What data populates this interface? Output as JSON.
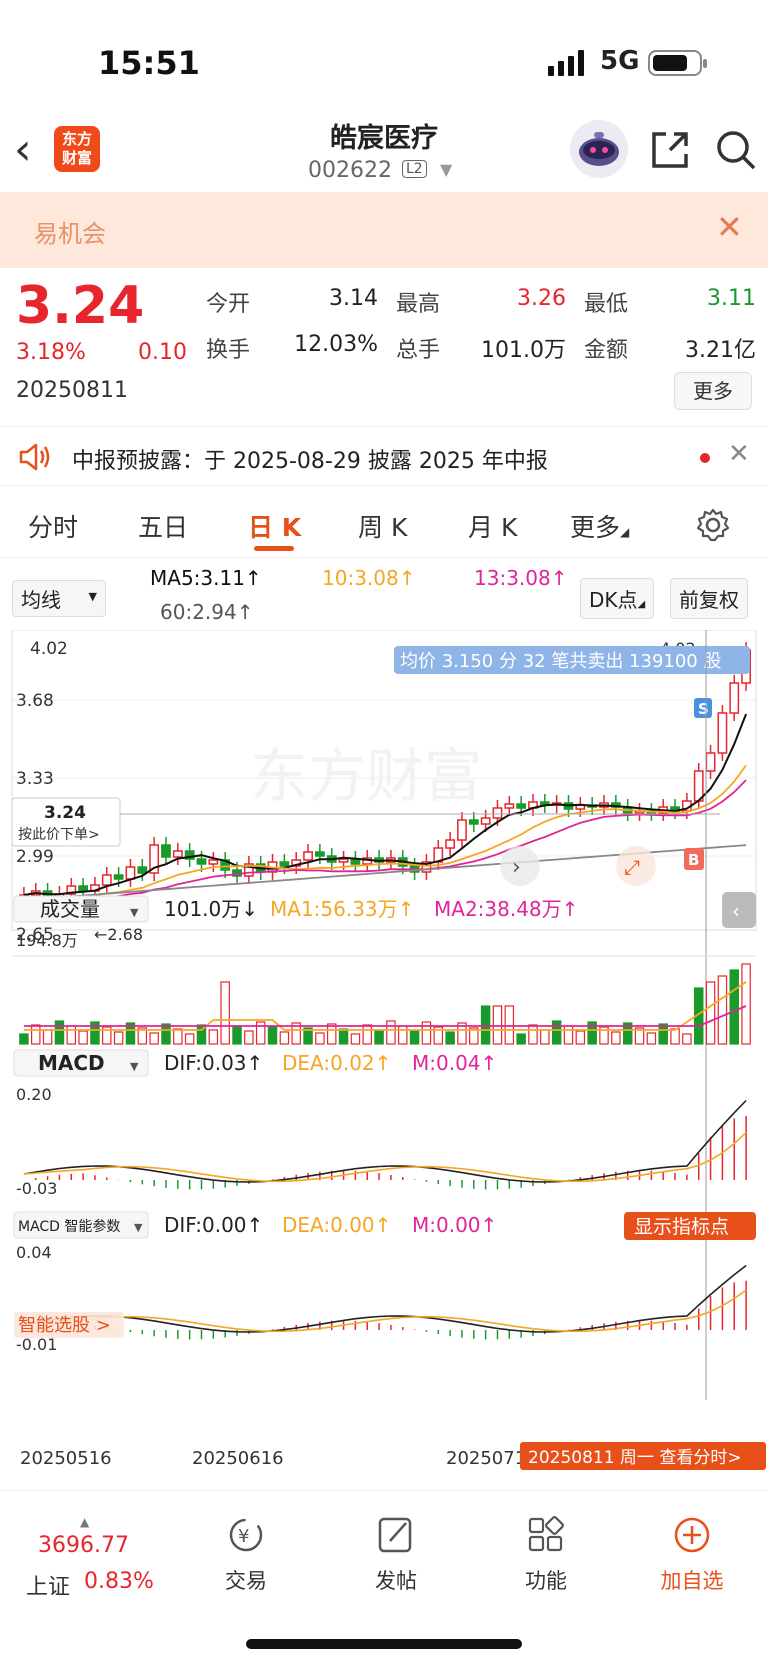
{
  "status": {
    "time": "15:51",
    "network": "5G"
  },
  "nav": {
    "logo_text_1": "东方",
    "logo_text_2": "财富",
    "stock_name": "皓宸医疗",
    "stock_code": "002622",
    "level": "L2"
  },
  "banner": {
    "text": "易机会"
  },
  "quote": {
    "price": "3.24",
    "change_pct": "3.18%",
    "change": "0.10",
    "date": "20250811",
    "open_label": "今开",
    "open": "3.14",
    "high_label": "最高",
    "high": "3.26",
    "low_label": "最低",
    "low": "3.11",
    "turnover_label": "换手",
    "turnover": "12.03%",
    "volume_label": "总手",
    "volume": "101.0万",
    "amount_label": "金额",
    "amount": "3.21亿",
    "more": "更多"
  },
  "notice": {
    "text": "中报预披露：于 2025-08-29 披露 2025 年中报"
  },
  "tabs": [
    "分时",
    "五日",
    "日 K",
    "周 K",
    "月 K",
    "更多"
  ],
  "active_tab": "日 K",
  "ma": {
    "selector": "均线",
    "ma5": "MA5:3.11↑",
    "ma10": "10:3.08↑",
    "ma13": "13:3.08↑",
    "ma60": "60:2.94↑",
    "dk_btn": "DK点",
    "adjust_btn": "前复权"
  },
  "kline": {
    "ymax": "4.02",
    "y1": "3.68",
    "y2": "3.33",
    "y3": "2.99",
    "ymin": "2.65",
    "price_tag": "3.24",
    "price_tag_sub": "按此价下单>",
    "low_mark": "←2.68",
    "high_mark": "4.02→",
    "tooltip": "均价 3.150 分 32 笔共卖出 139100 股",
    "watermark": "东方财富",
    "signal_s": "S",
    "signal_b": "B"
  },
  "volume": {
    "selector": "成交量",
    "value": "101.0万↓",
    "ma1": "MA1:56.33万↑",
    "ma2": "MA2:38.48万↑",
    "ymax": "194.8万"
  },
  "macd": {
    "selector": "MACD",
    "dif": "DIF:0.03↑",
    "dea": "DEA:0.02↑",
    "m": "M:0.04↑",
    "ymax": "0.20",
    "ymin": "-0.03"
  },
  "smart": {
    "selector": "MACD 智能参数",
    "dif": "DIF:0.00↑",
    "dea": "DEA:0.00↑",
    "m": "M:0.00↑",
    "show_btn": "显示指标点",
    "ymax": "0.04",
    "ymin": "-0.01",
    "pick_tag": "智能选股 >"
  },
  "xaxis": {
    "d1": "20250516",
    "d2": "20250616",
    "d3": "20250716",
    "d4": "20250811"
  },
  "cursor_tag": "20250811 周一 查看分时>",
  "footer": {
    "index_value": "3696.77",
    "index_name": "上证",
    "index_pct": "0.83%",
    "items": [
      "交易",
      "发帖",
      "功能",
      "加自选"
    ]
  },
  "colors": {
    "up": "#e6252c",
    "down": "#1a9a2a",
    "accent": "#e8501a",
    "ma5": "#111111",
    "ma10": "#f5a623",
    "ma13": "#e0249a",
    "ma60": "#888888"
  },
  "chart_data": {
    "type": "candlestick",
    "title": "",
    "series": [
      {
        "name": "MA5",
        "values": [
          3.11
        ]
      },
      {
        "name": "MA10",
        "values": [
          3.08
        ]
      },
      {
        "name": "MA13",
        "values": [
          3.08
        ]
      },
      {
        "name": "MA60",
        "values": [
          2.94
        ]
      }
    ],
    "ylim": [
      2.65,
      4.02
    ],
    "x_ticks": [
      "20250516",
      "20250616",
      "20250716",
      "20250811"
    ],
    "last_bar": {
      "open": 3.14,
      "high": 3.26,
      "low": 3.11,
      "close": 3.24
    }
  }
}
